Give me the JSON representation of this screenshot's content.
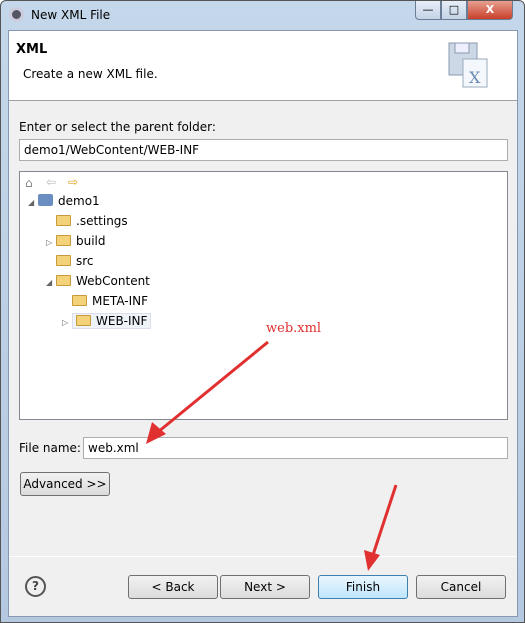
{
  "window": {
    "title": "New XML File",
    "min": "—",
    "max": "□",
    "close": "X"
  },
  "header": {
    "title": "XML",
    "description": "Create a new XML file."
  },
  "parent_folder": {
    "label": "Enter or select the parent folder:",
    "value": "demo1/WebContent/WEB-INF"
  },
  "tree": {
    "items": [
      {
        "label": "demo1",
        "twisty": "◢"
      },
      {
        "label": ".settings",
        "twisty": ""
      },
      {
        "label": "build",
        "twisty": "▷"
      },
      {
        "label": "src",
        "twisty": ""
      },
      {
        "label": "WebContent",
        "twisty": "◢"
      },
      {
        "label": "META-INF",
        "twisty": ""
      },
      {
        "label": "WEB-INF",
        "twisty": "▷"
      }
    ]
  },
  "file_name": {
    "label": "File name:",
    "value": "web.xml"
  },
  "advanced_label": "Advanced >>",
  "buttons": {
    "back": "< Back",
    "next": "Next >",
    "finish": "Finish",
    "cancel": "Cancel"
  },
  "help": "?",
  "annotation": "web.xml",
  "colors": {
    "annotation": "#e03030",
    "folder": "#f3d27a"
  }
}
